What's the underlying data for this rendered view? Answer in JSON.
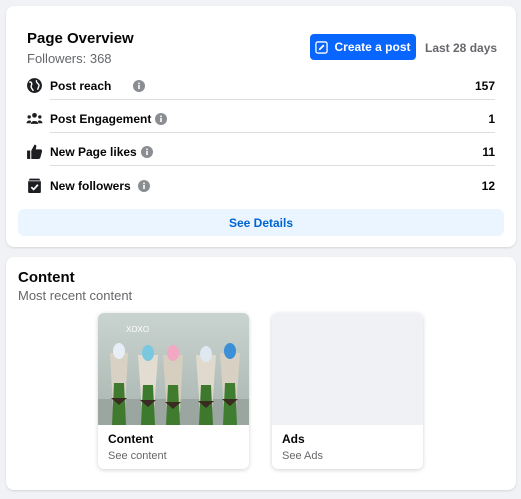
{
  "overview": {
    "title": "Page Overview",
    "followers": "Followers: 368",
    "create_label": "Create a post",
    "range_label": "Last 28 days",
    "metrics": [
      {
        "label": "Post reach",
        "value": "157",
        "icon": "globe-icon"
      },
      {
        "label": "Post Engagement",
        "value": "1",
        "icon": "people-icon"
      },
      {
        "label": "New Page likes",
        "value": "11",
        "icon": "thumbs-up-icon"
      },
      {
        "label": "New followers",
        "value": "12",
        "icon": "follow-check-icon"
      }
    ],
    "details_label": "See Details"
  },
  "content": {
    "title": "Content",
    "subtitle": "Most recent content",
    "tiles": [
      {
        "title": "Content",
        "subtitle": "See content",
        "image_text": "XOXO"
      },
      {
        "title": "Ads",
        "subtitle": "See Ads"
      }
    ]
  },
  "colors": {
    "accent": "#0866ff",
    "accent_light": "#ebf5ff",
    "link": "#0064d1",
    "background": "#f0f2f5",
    "secondary_text": "#65676b"
  }
}
